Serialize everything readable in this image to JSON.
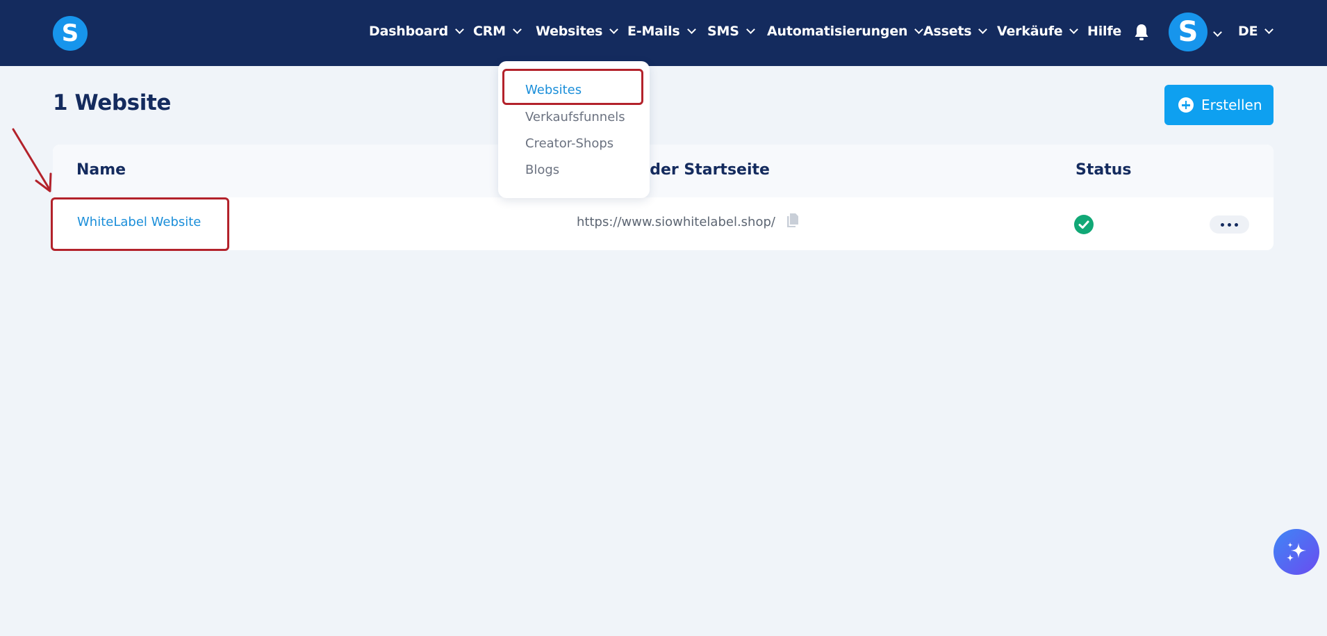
{
  "header": {
    "logo_letter": "S",
    "nav": [
      {
        "label": "Dashboard"
      },
      {
        "label": "CRM"
      },
      {
        "label": "Websites"
      },
      {
        "label": "E-Mails"
      },
      {
        "label": "SMS"
      },
      {
        "label": "Automatisierungen"
      },
      {
        "label": "Assets"
      },
      {
        "label": "Verkäufe"
      },
      {
        "label": "Hilfe"
      }
    ],
    "avatar_letter": "S",
    "language": "DE",
    "icons": {
      "notifications": "bell-icon",
      "chevron": "chevron-down-icon"
    }
  },
  "dropdown": {
    "items": [
      {
        "label": "Websites",
        "active": true
      },
      {
        "label": "Verkaufsfunnels"
      },
      {
        "label": "Creator-Shops"
      },
      {
        "label": "Blogs"
      }
    ]
  },
  "page": {
    "title": "1 Website",
    "create_button": "Erstellen"
  },
  "table": {
    "columns": {
      "name": "Name",
      "url_partial": "l der Startseite",
      "status": "Status"
    },
    "rows": [
      {
        "name": "WhiteLabel Website",
        "url": "https://www.siowhitelabel.shop/",
        "status": "check-circle-icon"
      }
    ]
  },
  "colors": {
    "header_bg": "#142b5e",
    "accent": "#0ea0f0",
    "link": "#1a8ed9",
    "status_ok": "#11a876",
    "annotation": "#b3222b"
  }
}
